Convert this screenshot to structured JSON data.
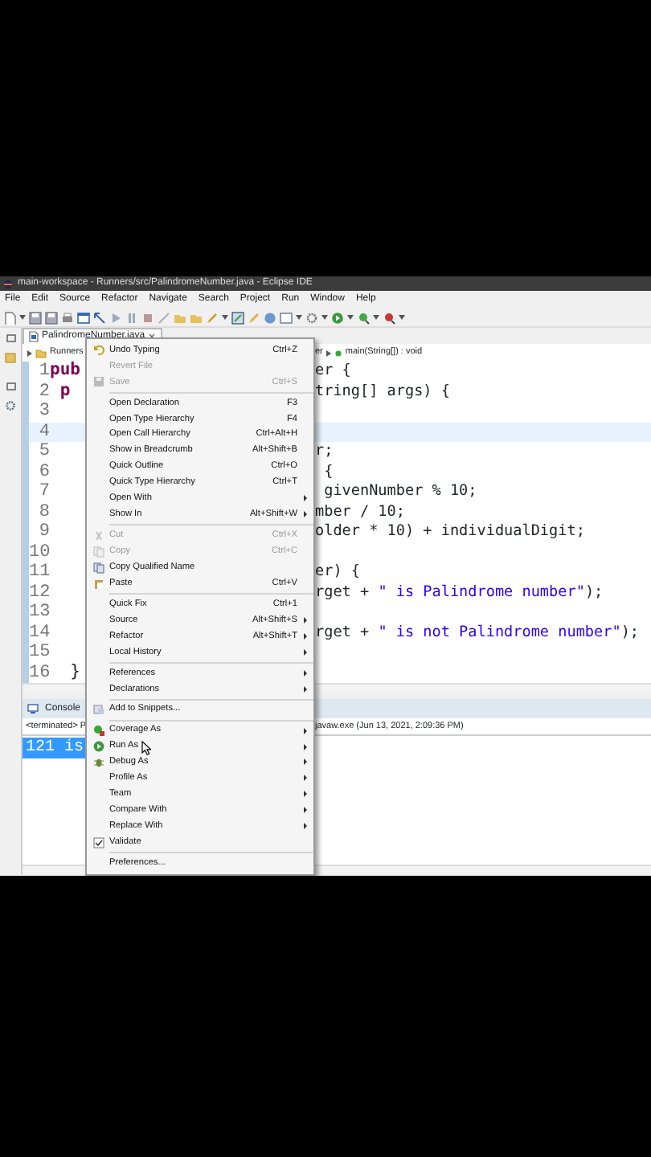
{
  "window": {
    "title": "main-workspace - Runners/src/PalindromeNumber.java - Eclipse IDE"
  },
  "menu_bar": [
    "File",
    "Edit",
    "Source",
    "Refactor",
    "Navigate",
    "Search",
    "Project",
    "Run",
    "Window",
    "Help"
  ],
  "editor": {
    "tab": {
      "label": "PalindromeNumber.java",
      "selected": true
    },
    "breadcrumb": {
      "project": "Runners",
      "class_tail": "er",
      "method": "main(String[]) : void"
    },
    "lines": [
      {
        "number": "1",
        "highlighted": false,
        "left": [
          {
            "text": "pub",
            "kind": "keyword"
          }
        ],
        "right": [
          {
            "text": "er {",
            "kind": "plain"
          }
        ]
      },
      {
        "number": "2",
        "highlighted": false,
        "left": [
          {
            "text": " p",
            "kind": "keyword"
          }
        ],
        "right": [
          {
            "text": "tring[] args) {",
            "kind": "plain"
          }
        ]
      },
      {
        "number": "3",
        "highlighted": false
      },
      {
        "number": "4",
        "highlighted": true
      },
      {
        "number": "5",
        "highlighted": false,
        "right": [
          {
            "text": "r;",
            "kind": "plain"
          }
        ]
      },
      {
        "number": "6",
        "highlighted": false,
        "right": [
          {
            "text": " {",
            "kind": "plain"
          }
        ]
      },
      {
        "number": "7",
        "highlighted": false,
        "right": [
          {
            "text": " givenNumber % 10;",
            "kind": "plain"
          }
        ]
      },
      {
        "number": "8",
        "highlighted": false,
        "right": [
          {
            "text": "mber / 10;",
            "kind": "plain"
          }
        ]
      },
      {
        "number": "9",
        "highlighted": false,
        "right": [
          {
            "text": "older * 10) + individualDigit;",
            "kind": "plain"
          }
        ]
      },
      {
        "number": "10",
        "highlighted": false
      },
      {
        "number": "11",
        "highlighted": false,
        "right": [
          {
            "text": "er) {",
            "kind": "plain"
          }
        ]
      },
      {
        "number": "12",
        "highlighted": false,
        "right": [
          {
            "text": "rget + ",
            "kind": "plain"
          },
          {
            "text": "\" is Palindrome number\"",
            "kind": "string"
          },
          {
            "text": ");",
            "kind": "plain"
          }
        ]
      },
      {
        "number": "13",
        "highlighted": false
      },
      {
        "number": "14",
        "highlighted": false,
        "right": [
          {
            "text": "rget + ",
            "kind": "plain"
          },
          {
            "text": "\" is not Palindrome number\"",
            "kind": "string"
          },
          {
            "text": ");",
            "kind": "plain"
          }
        ]
      },
      {
        "number": "15",
        "highlighted": false
      },
      {
        "number": "16",
        "highlighted": false,
        "left": [
          {
            "text": "  }",
            "kind": "plain"
          }
        ]
      }
    ]
  },
  "console": {
    "tab": {
      "label": "Console",
      "selected": true
    },
    "status_left": "<terminated> P",
    "status_right": "javaw.exe (Jun 13, 2021, 2:09:36 PM)",
    "output": {
      "text": "121 is",
      "selected": true
    }
  },
  "context_menu": [
    {
      "label": "Undo Typing",
      "shortcut": "Ctrl+Z",
      "kind": "undo",
      "disabled": false,
      "submenu": false
    },
    {
      "label": "Revert File",
      "kind": "plain",
      "disabled": true,
      "submenu": false
    },
    {
      "label": "Save",
      "shortcut": "Ctrl+S",
      "kind": "save",
      "disabled": true,
      "submenu": false
    },
    {
      "kind": "separator"
    },
    {
      "label": "Open Declaration",
      "shortcut": "F3",
      "kind": "plain",
      "disabled": false,
      "submenu": false
    },
    {
      "label": "Open Type Hierarchy",
      "shortcut": "F4",
      "kind": "plain",
      "disabled": false,
      "submenu": false
    },
    {
      "label": "Open Call Hierarchy",
      "shortcut": "Ctrl+Alt+H",
      "kind": "plain",
      "disabled": false,
      "submenu": false
    },
    {
      "label": "Show in Breadcrumb",
      "shortcut": "Alt+Shift+B",
      "kind": "plain",
      "disabled": false,
      "submenu": false
    },
    {
      "label": "Quick Outline",
      "shortcut": "Ctrl+O",
      "kind": "plain",
      "disabled": false,
      "submenu": false
    },
    {
      "label": "Quick Type Hierarchy",
      "shortcut": "Ctrl+T",
      "kind": "plain",
      "disabled": false,
      "submenu": false
    },
    {
      "label": "Open With",
      "kind": "plain",
      "disabled": false,
      "submenu": true
    },
    {
      "label": "Show In",
      "shortcut": "Alt+Shift+W",
      "kind": "plain",
      "disabled": false,
      "submenu": true
    },
    {
      "kind": "separator"
    },
    {
      "label": "Cut",
      "shortcut": "Ctrl+X",
      "kind": "cut",
      "disabled": true,
      "submenu": false
    },
    {
      "label": "Copy",
      "shortcut": "Ctrl+C",
      "kind": "copy",
      "disabled": true,
      "submenu": false
    },
    {
      "label": "Copy Qualified Name",
      "kind": "copy-name",
      "disabled": false,
      "submenu": false
    },
    {
      "label": "Paste",
      "shortcut": "Ctrl+V",
      "kind": "paste",
      "disabled": false,
      "submenu": false
    },
    {
      "kind": "separator"
    },
    {
      "label": "Quick Fix",
      "shortcut": "Ctrl+1",
      "kind": "plain",
      "disabled": false,
      "submenu": false
    },
    {
      "label": "Source",
      "shortcut": "Alt+Shift+S",
      "kind": "plain",
      "disabled": false,
      "submenu": true
    },
    {
      "label": "Refactor",
      "shortcut": "Alt+Shift+T",
      "kind": "plain",
      "disabled": false,
      "submenu": true
    },
    {
      "label": "Local History",
      "kind": "plain",
      "disabled": false,
      "submenu": true
    },
    {
      "kind": "separator"
    },
    {
      "label": "References",
      "kind": "plain",
      "disabled": false,
      "submenu": true
    },
    {
      "label": "Declarations",
      "kind": "plain",
      "disabled": false,
      "submenu": true
    },
    {
      "kind": "separator"
    },
    {
      "label": "Add to Snippets...",
      "kind": "snippet",
      "disabled": false,
      "submenu": false
    },
    {
      "kind": "separator"
    },
    {
      "label": "Coverage As",
      "kind": "coverage",
      "disabled": false,
      "submenu": true
    },
    {
      "label": "Run As",
      "kind": "run",
      "disabled": false,
      "submenu": true
    },
    {
      "label": "Debug As",
      "kind": "debug",
      "disabled": false,
      "submenu": true
    },
    {
      "label": "Profile As",
      "kind": "plain",
      "disabled": false,
      "submenu": true
    },
    {
      "label": "Team",
      "kind": "plain",
      "disabled": false,
      "submenu": true
    },
    {
      "label": "Compare With",
      "kind": "plain",
      "disabled": false,
      "submenu": true
    },
    {
      "label": "Replace With",
      "kind": "plain",
      "disabled": false,
      "submenu": true
    },
    {
      "label": "Validate",
      "kind": "validate",
      "disabled": false,
      "submenu": false
    },
    {
      "kind": "separator"
    },
    {
      "label": "Preferences...",
      "kind": "plain",
      "disabled": false,
      "submenu": false
    }
  ]
}
